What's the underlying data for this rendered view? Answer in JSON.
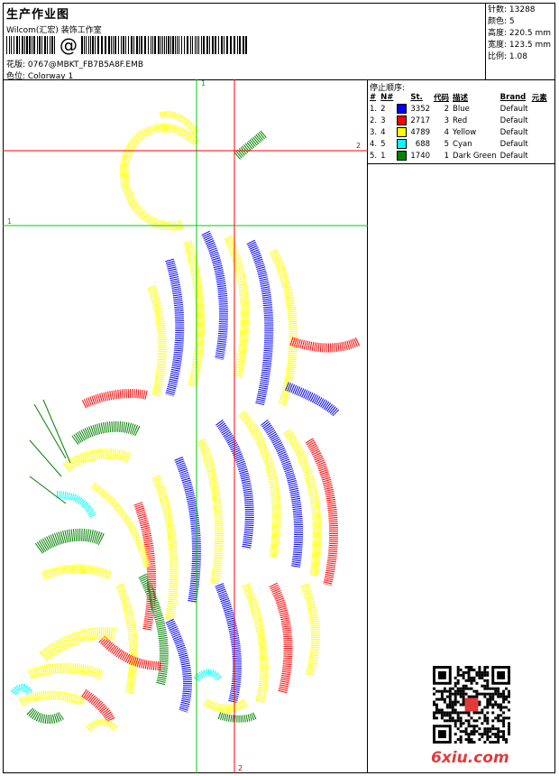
{
  "header": {
    "title": "生产作业图",
    "company": "Wilcom(汇宏) 装饰工作室",
    "design_file": "花版: 0767@MBKT_FB7B5A8F.EMB",
    "colorway": "色位: Colorway 1"
  },
  "stats": {
    "stitches": "针数: 13288",
    "colors": "颜色: 5",
    "height": "高度: 220.5 mm",
    "width": "宽度: 123.5 mm",
    "ratio": "比例: 1.08"
  },
  "stop_sequence": {
    "title": "停止顺序:",
    "headers": [
      "#",
      "N#",
      "St.",
      "代码",
      "描述",
      "Brand",
      "元素"
    ],
    "rows": [
      {
        "num": "1.",
        "n": "2",
        "color": "#0000ff",
        "stitches": "3352",
        "code": "2",
        "desc": "Blue",
        "brand": "Default"
      },
      {
        "num": "2.",
        "n": "3",
        "color": "#ff0000",
        "stitches": "2717",
        "code": "3",
        "desc": "Red",
        "brand": "Default"
      },
      {
        "num": "3.",
        "n": "4",
        "color": "#ffff00",
        "stitches": "4789",
        "code": "4",
        "desc": "Yellow",
        "brand": "Default"
      },
      {
        "num": "4.",
        "n": "5",
        "color": "#00ffff",
        "stitches": "688",
        "code": "5",
        "desc": "Cyan",
        "brand": "Default"
      },
      {
        "num": "5.",
        "n": "1",
        "color": "#008000",
        "stitches": "1740",
        "code": "1",
        "desc": "Dark Green",
        "brand": "Default"
      }
    ]
  },
  "markers": {
    "green_1_top": "1",
    "green_1_left": "1",
    "red_2_right": "2",
    "red_2_bottom": "2"
  },
  "watermark": "6xiu.com",
  "barcode_symbol": "@"
}
